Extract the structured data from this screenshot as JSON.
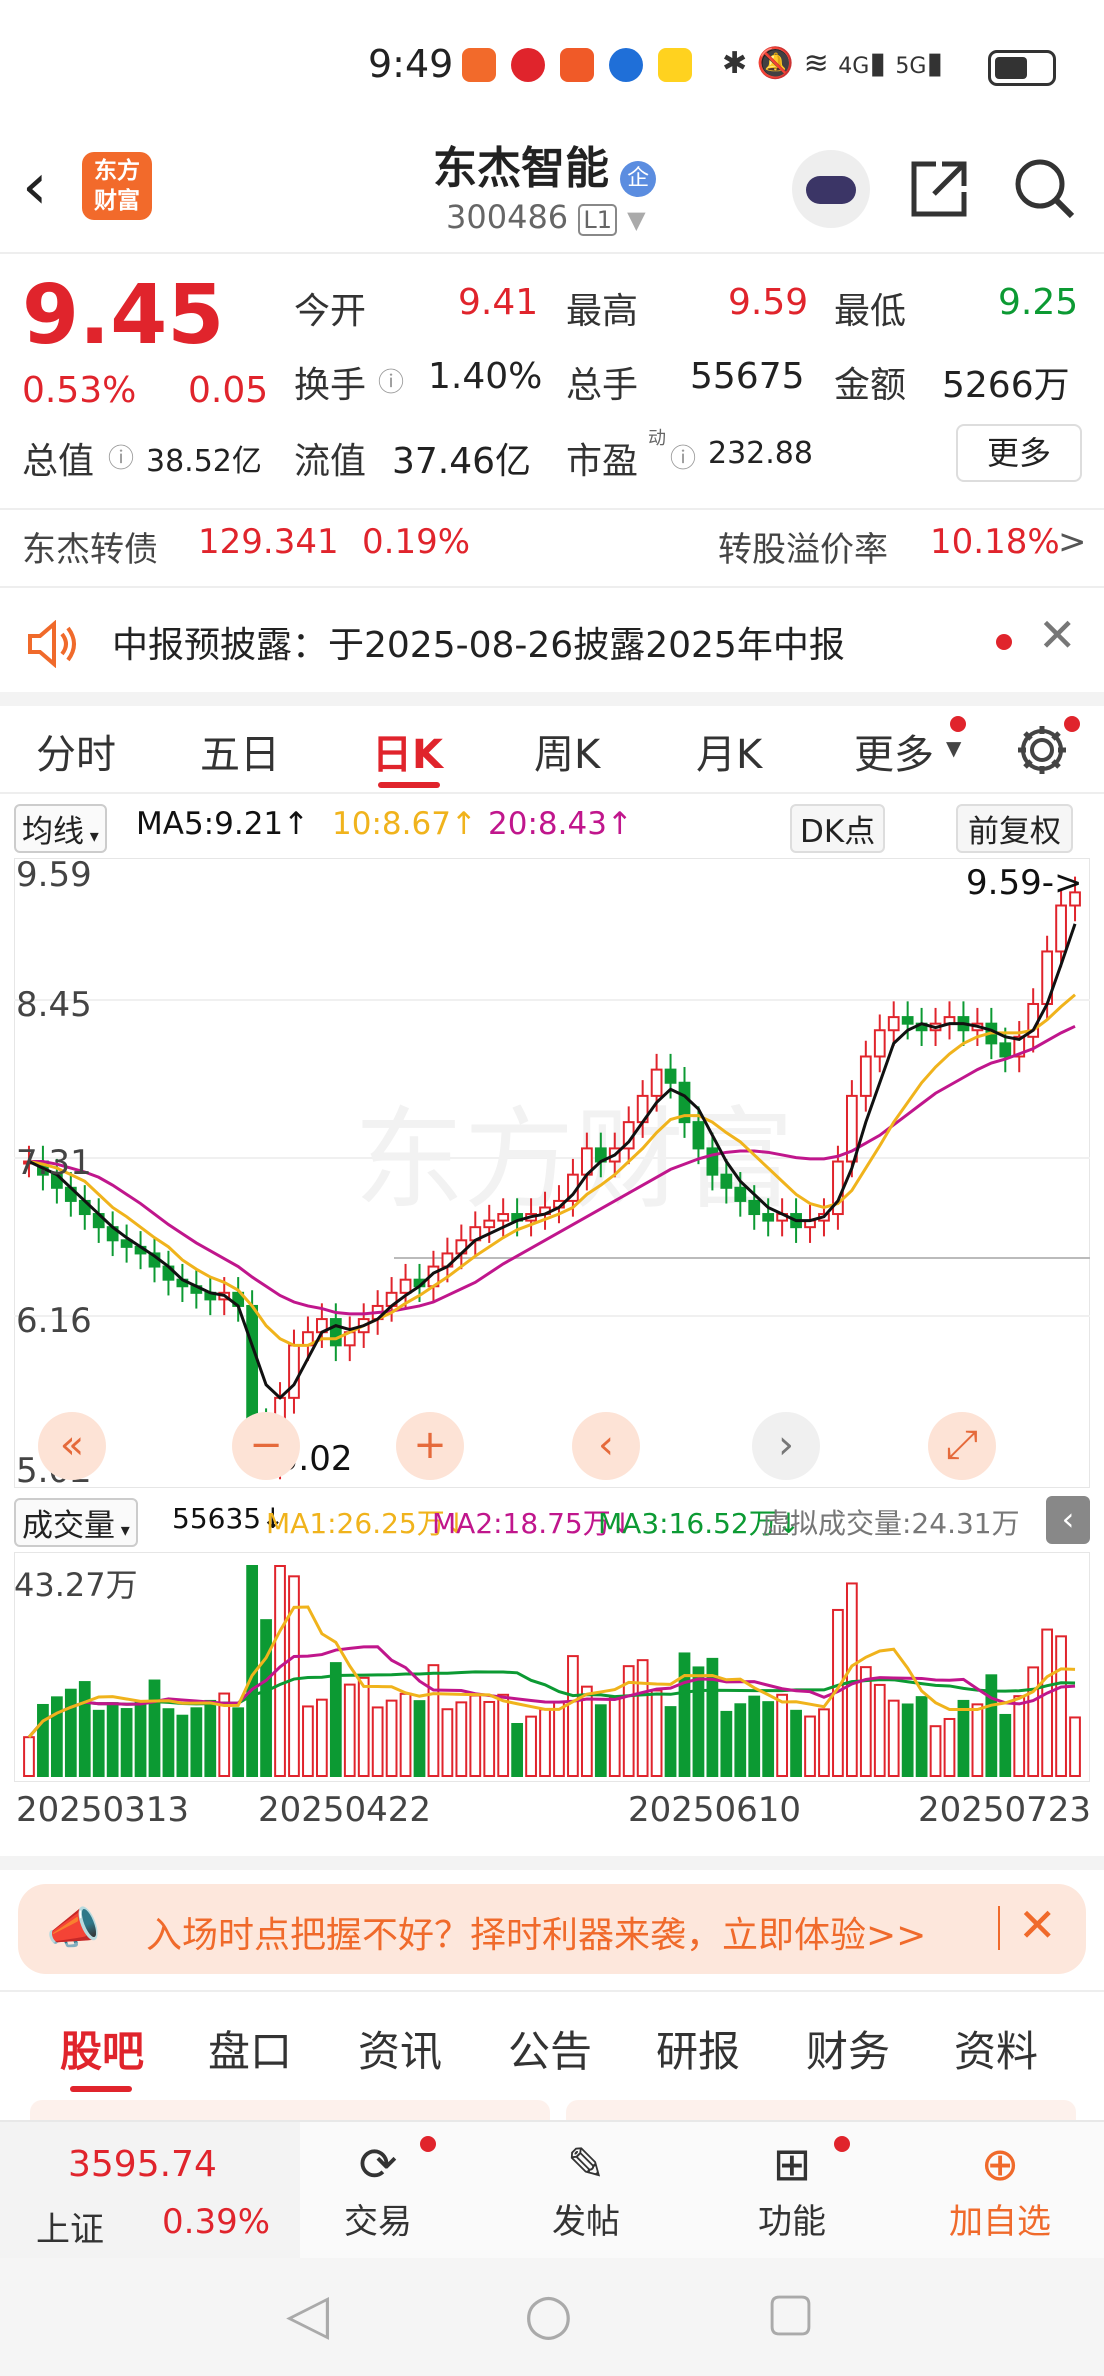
{
  "status_bar": {
    "time": "9:49",
    "network1": "4G",
    "network2": "5G"
  },
  "header": {
    "title": "东杰智能",
    "badge": "企",
    "code": "300486",
    "level": "L1",
    "logo_line1": "东方",
    "logo_line2": "财富"
  },
  "quote": {
    "price": "9.45",
    "change_pct": "0.53%",
    "change": "0.05",
    "open_label": "今开",
    "open": "9.41",
    "high_label": "最高",
    "high": "9.59",
    "low_label": "最低",
    "low": "9.25",
    "turnover_label": "换手",
    "turnover": "1.40%",
    "volume_label": "总手",
    "volume": "55675",
    "amount_label": "金额",
    "amount": "5266万",
    "mktcap_label": "总值",
    "mktcap": "38.52亿",
    "float_label": "流值",
    "float": "37.46亿",
    "pe_label": "市盈",
    "pe_sup": "动",
    "pe": "232.88",
    "more_label": "更多"
  },
  "bond": {
    "name": "东杰转债",
    "price": "129.341",
    "pct": "0.19%",
    "premium_label": "转股溢价率",
    "premium": "10.18%",
    "arrow": ">"
  },
  "notice": {
    "text": "中报预披露：于2025-08-26披露2025年中报"
  },
  "ktabs": [
    "分时",
    "五日",
    "日K",
    "周K",
    "月K",
    "更多"
  ],
  "ma_bar": {
    "select": "均线",
    "ma5": "MA5:9.21↑",
    "ma10": "10:8.67↑",
    "ma20": "20:8.43↑",
    "dk": "DK点",
    "adjust": "前复权"
  },
  "price_axis": [
    "9.59",
    "8.45",
    "7.31",
    "6.16",
    "5.02"
  ],
  "price_annotations": {
    "high": "9.59->",
    "low": "<-5.02"
  },
  "vol_bar": {
    "select": "成交量",
    "vol": "55635↓",
    "ma1": "MA1:26.25万↓",
    "ma2": "MA2:18.75万↓",
    "ma3": "MA3:16.52万↓",
    "virtual": "虚拟成交量:24.31万"
  },
  "vol_axis": "43.27万",
  "dates": [
    "20250313",
    "20250422",
    "20250610",
    "20250723"
  ],
  "watermark": "东方财富",
  "ad": {
    "text": "入场时点把握不好？择时利器来袭，立即体验>>"
  },
  "bottom_tabs": [
    "股吧",
    "盘口",
    "资讯",
    "公告",
    "研报",
    "财务",
    "资料"
  ],
  "bottom_nav": {
    "index_value": "3595.74",
    "index_name": "上证",
    "index_pct": "0.39%",
    "items": [
      {
        "label": "交易",
        "icon": "trade-icon"
      },
      {
        "label": "发帖",
        "icon": "post-icon"
      },
      {
        "label": "功能",
        "icon": "function-icon"
      },
      {
        "label": "加自选",
        "icon": "add-watchlist-icon"
      }
    ]
  },
  "colors": {
    "up": "#e0242c",
    "down": "#0c9a33",
    "ma5": "#111111",
    "ma10": "#f0b31c",
    "ma20": "#c0168c",
    "accent": "#f06a2b"
  },
  "chart_data": {
    "type": "candlestick",
    "ylim": [
      5.02,
      9.59
    ],
    "yticks": [
      9.59,
      8.45,
      7.31,
      6.16,
      5.02
    ],
    "closes": [
      7.4,
      7.3,
      7.2,
      7.1,
      7.0,
      6.9,
      6.8,
      6.75,
      6.7,
      6.6,
      6.5,
      6.45,
      6.4,
      6.35,
      6.4,
      6.3,
      5.4,
      5.1,
      5.6,
      6.0,
      6.1,
      6.2,
      6.0,
      6.1,
      6.2,
      6.3,
      6.4,
      6.5,
      6.45,
      6.6,
      6.7,
      6.8,
      6.9,
      6.95,
      7.0,
      6.95,
      7.0,
      7.05,
      7.1,
      7.3,
      7.5,
      7.4,
      7.5,
      7.7,
      7.9,
      8.1,
      8.0,
      7.7,
      7.5,
      7.3,
      7.2,
      7.1,
      7.0,
      6.95,
      7.0,
      6.9,
      6.95,
      7.0,
      7.4,
      7.9,
      8.2,
      8.4,
      8.5,
      8.45,
      8.4,
      8.45,
      8.5,
      8.4,
      8.45,
      8.3,
      8.2,
      8.35,
      8.6,
      9.0,
      9.35,
      9.45
    ],
    "ma5": [
      7.4,
      7.35,
      7.3,
      7.2,
      7.1,
      7.0,
      6.9,
      6.82,
      6.75,
      6.68,
      6.6,
      6.5,
      6.45,
      6.4,
      6.38,
      6.3,
      6.0,
      5.7,
      5.6,
      5.7,
      5.9,
      6.1,
      6.15,
      6.12,
      6.15,
      6.2,
      6.3,
      6.38,
      6.45,
      6.55,
      6.6,
      6.7,
      6.8,
      6.85,
      6.9,
      6.95,
      6.98,
      7.0,
      7.05,
      7.15,
      7.3,
      7.4,
      7.45,
      7.55,
      7.7,
      7.85,
      7.95,
      7.9,
      7.8,
      7.6,
      7.4,
      7.25,
      7.15,
      7.05,
      7.0,
      6.95,
      6.95,
      6.98,
      7.1,
      7.35,
      7.7,
      8.0,
      8.3,
      8.4,
      8.45,
      8.42,
      8.45,
      8.45,
      8.43,
      8.4,
      8.35,
      8.33,
      8.4,
      8.6,
      8.9,
      9.21
    ],
    "ma10": [
      7.4,
      7.38,
      7.35,
      7.3,
      7.25,
      7.15,
      7.05,
      6.98,
      6.9,
      6.82,
      6.75,
      6.65,
      6.58,
      6.52,
      6.48,
      6.42,
      6.3,
      6.15,
      6.05,
      6.0,
      6.0,
      6.05,
      6.05,
      6.1,
      6.15,
      6.2,
      6.25,
      6.32,
      6.38,
      6.45,
      6.52,
      6.6,
      6.68,
      6.75,
      6.82,
      6.88,
      6.92,
      6.96,
      7.0,
      7.05,
      7.15,
      7.22,
      7.3,
      7.4,
      7.5,
      7.62,
      7.72,
      7.75,
      7.75,
      7.7,
      7.62,
      7.55,
      7.45,
      7.35,
      7.25,
      7.15,
      7.08,
      7.05,
      7.08,
      7.18,
      7.35,
      7.52,
      7.7,
      7.85,
      8.0,
      8.12,
      8.22,
      8.3,
      8.35,
      8.38,
      8.38,
      8.38,
      8.4,
      8.48,
      8.58,
      8.67
    ],
    "ma20": [
      7.4,
      7.4,
      7.38,
      7.35,
      7.32,
      7.28,
      7.22,
      7.15,
      7.08,
      7.0,
      6.92,
      6.85,
      6.78,
      6.72,
      6.66,
      6.6,
      6.52,
      6.45,
      6.38,
      6.33,
      6.3,
      6.28,
      6.25,
      6.24,
      6.24,
      6.25,
      6.26,
      6.28,
      6.3,
      6.33,
      6.38,
      6.43,
      6.48,
      6.55,
      6.62,
      6.68,
      6.74,
      6.8,
      6.86,
      6.92,
      6.98,
      7.04,
      7.1,
      7.16,
      7.22,
      7.28,
      7.34,
      7.38,
      7.42,
      7.45,
      7.47,
      7.48,
      7.48,
      7.47,
      7.45,
      7.43,
      7.42,
      7.42,
      7.44,
      7.48,
      7.54,
      7.6,
      7.68,
      7.76,
      7.84,
      7.92,
      7.98,
      8.04,
      8.1,
      8.15,
      8.18,
      8.22,
      8.26,
      8.32,
      8.38,
      8.43
    ],
    "volume_ylim": [
      0,
      43.27
    ]
  }
}
